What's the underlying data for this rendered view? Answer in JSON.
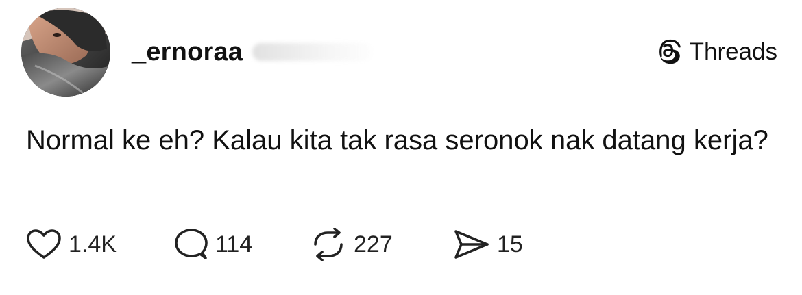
{
  "post": {
    "author": {
      "username": "_ernoraa",
      "avatar_icon": "profile-photo"
    },
    "platform": {
      "label": "Threads",
      "icon": "threads-logo-icon"
    },
    "text": "Normal ke eh? Kalau kita tak rasa seronok nak datang kerja?",
    "actions": {
      "likes": {
        "icon": "heart-icon",
        "count": "1.4K"
      },
      "replies": {
        "icon": "speech-bubble-icon",
        "count": "114"
      },
      "reposts": {
        "icon": "repost-icon",
        "count": "227"
      },
      "shares": {
        "icon": "send-icon",
        "count": "15"
      }
    }
  },
  "colors": {
    "text": "#111111",
    "background": "#ffffff",
    "divider": "#dddddd"
  }
}
